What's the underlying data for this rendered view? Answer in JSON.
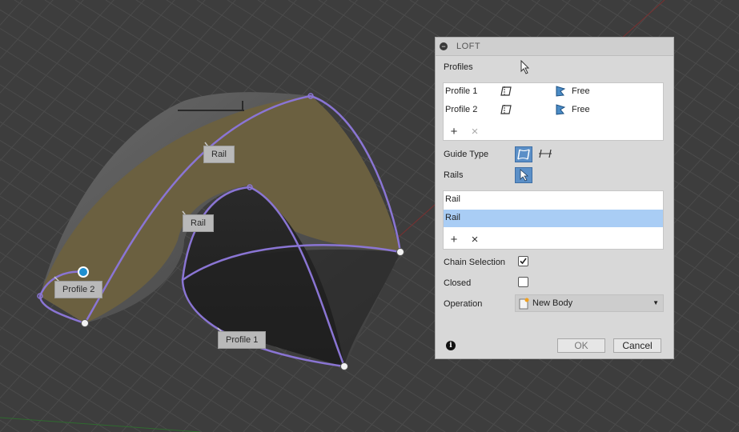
{
  "viewport": {
    "labels": {
      "rail_top": "Rail",
      "rail_mid": "Rail",
      "profile_2": "Profile 2",
      "profile_1": "Profile 1"
    }
  },
  "dialog": {
    "title": "LOFT",
    "collapse_icon": "minus-circle-icon",
    "profiles_label": "Profiles",
    "profiles": [
      {
        "name": "Profile 1",
        "condition": "Free"
      },
      {
        "name": "Profile 2",
        "condition": "Free"
      }
    ],
    "guide_type_label": "Guide Type",
    "rails_label": "Rails",
    "rails": [
      {
        "name": "Rail",
        "selected": false
      },
      {
        "name": "Rail",
        "selected": true
      }
    ],
    "chain_selection_label": "Chain Selection",
    "chain_selection_checked": true,
    "closed_label": "Closed",
    "closed_checked": false,
    "operation_label": "Operation",
    "operation_value": "New Body",
    "ok_label": "OK",
    "cancel_label": "Cancel"
  },
  "colors": {
    "viewport_bg": "#3d3d3d",
    "grid": "#4a4a4a",
    "sketch_purple": "#8a75d4",
    "surface_tan": "#6b6040",
    "selection_blue": "#a9cdf5",
    "active_tool_blue": "#5b8fc7"
  }
}
